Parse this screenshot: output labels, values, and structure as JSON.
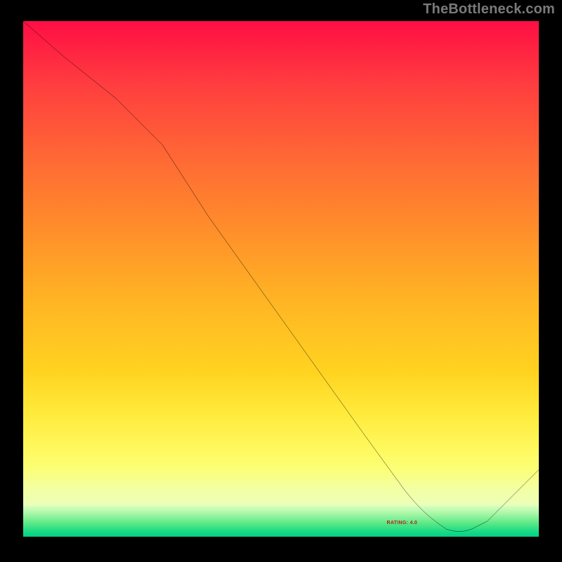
{
  "watermark": "TheBottleneck.com",
  "bottom_label": "RATING: 4.0",
  "chart_data": {
    "type": "line",
    "title": "",
    "xlabel": "",
    "ylabel": "",
    "xlim": [
      0,
      100
    ],
    "ylim": [
      0,
      100
    ],
    "grid": false,
    "background": "rainbow-vertical (red top → green bottom)",
    "series": [
      {
        "name": "curve",
        "x": [
          0,
          8,
          18,
          27,
          36,
          46,
          56,
          66,
          74,
          80,
          85,
          90,
          100
        ],
        "values": [
          100,
          93,
          85,
          76,
          62,
          48,
          34,
          20,
          9,
          3,
          1,
          3,
          13
        ]
      }
    ],
    "annotations": [
      {
        "text": "RATING: 4.0",
        "x": 82,
        "y": 2
      }
    ]
  }
}
